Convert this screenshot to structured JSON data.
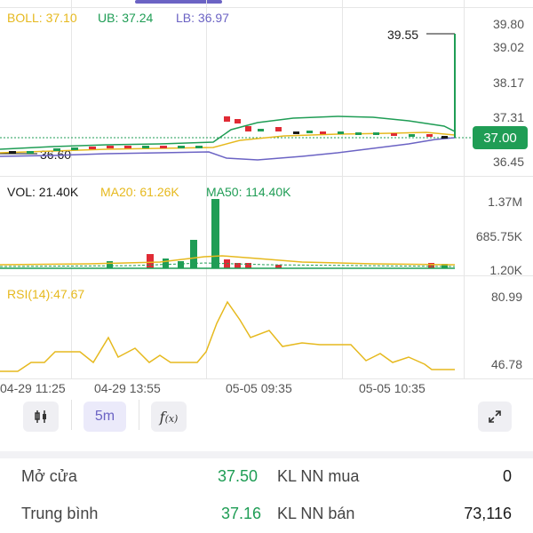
{
  "colors": {
    "green": "#1f9d55",
    "red": "#e02b35",
    "yellow": "#e6b91e",
    "purple": "#6b63c4",
    "blue_line": "#5b57c9",
    "text_grey": "#555555"
  },
  "price_chart": {
    "legend": {
      "boll": "BOLL: 37.10",
      "ub": "UB: 37.24",
      "lb": "LB: 36.97"
    },
    "y_ticks": [
      "39.80",
      "39.02",
      "38.17",
      "37.31",
      "36.45"
    ],
    "current_price": "37.00",
    "high_marker": "39.55",
    "low_marker": "36.60"
  },
  "volume_chart": {
    "legend": {
      "vol": "VOL: 21.40K",
      "ma20": "MA20: 61.26K",
      "ma50": "MA50: 114.40K"
    },
    "y_ticks": [
      "1.37M",
      "685.75K",
      "1.20K"
    ]
  },
  "rsi_chart": {
    "legend": "RSI(14):47.67",
    "y_ticks": [
      "80.99",
      "46.78"
    ]
  },
  "time_axis": [
    "04-29 11:25",
    "04-29 13:55",
    "05-05 09:35",
    "05-05 10:35"
  ],
  "toolbar": {
    "candle_icon": "candlestick-icon",
    "interval": "5m",
    "function_icon": "function-icon",
    "expand_icon": "expand-icon"
  },
  "stats": {
    "open_label": "Mở cửa",
    "open_value": "37.50",
    "avg_label": "Trung bình",
    "avg_value": "37.16",
    "foreign_buy_label": "KL NN mua",
    "foreign_buy_value": "0",
    "foreign_sell_label": "KL NN bán",
    "foreign_sell_value": "73,116"
  }
}
